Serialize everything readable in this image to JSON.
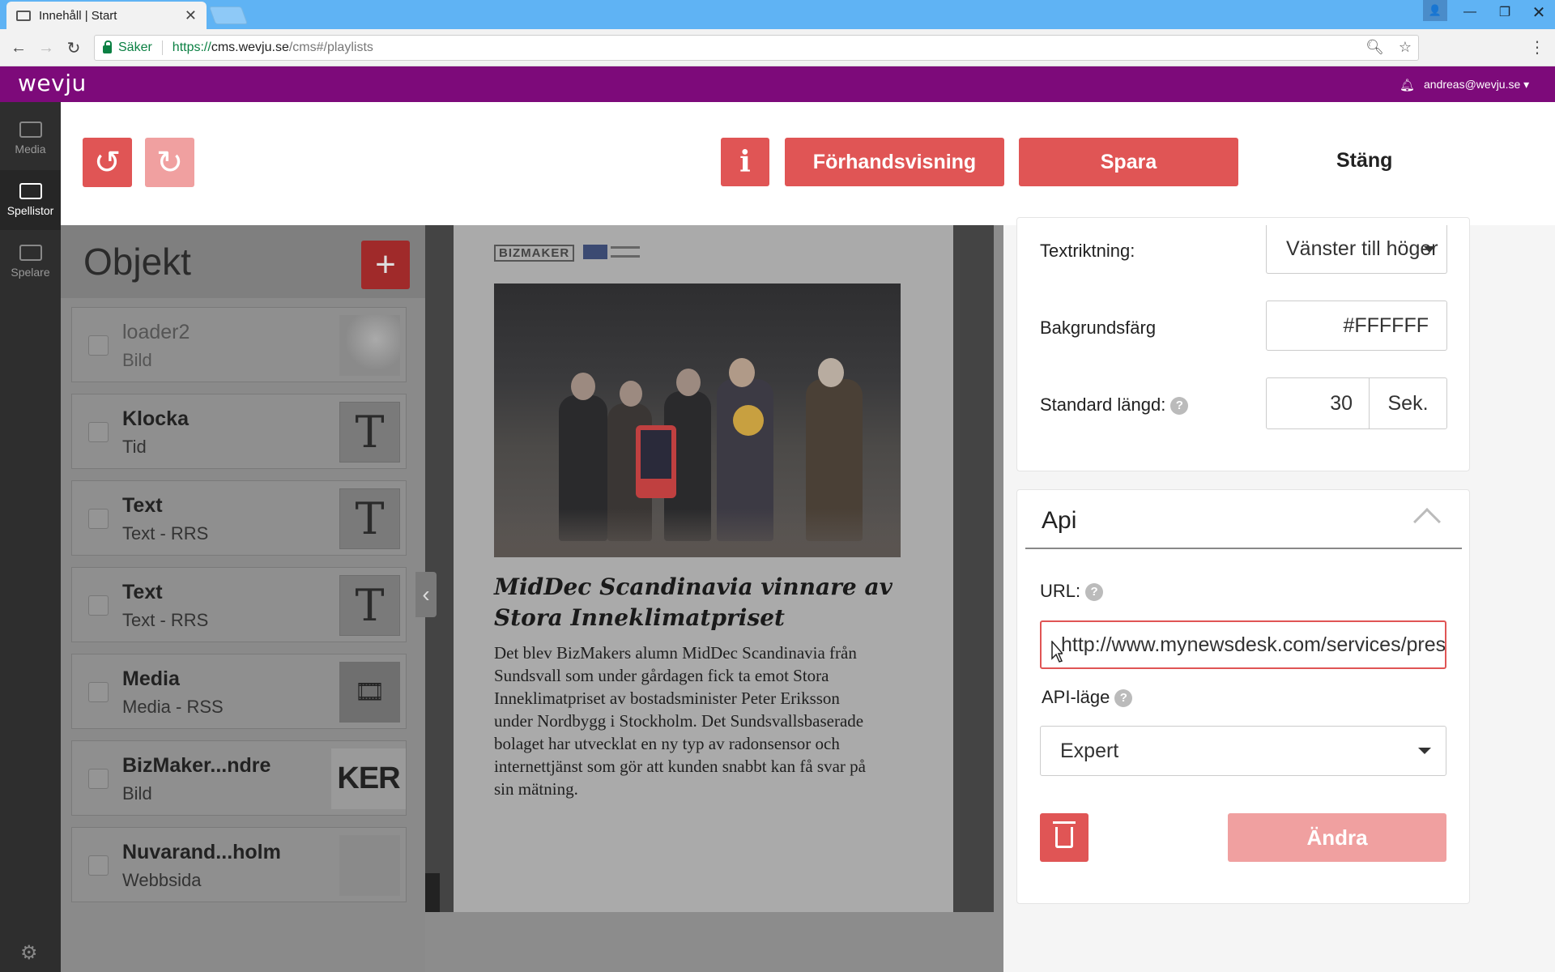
{
  "browser": {
    "tab_title": "Innehåll | Start",
    "secure_label": "Säker",
    "url_proto": "https://",
    "url_host": "cms.wevju.se",
    "url_path": "/cms#/playlists"
  },
  "app": {
    "logo": "wevju",
    "user_email": "andreas@wevju.se ▾"
  },
  "leftnav": {
    "items": [
      {
        "label": "Media",
        "icon": "media-icon"
      },
      {
        "label": "Spellistor",
        "icon": "playlist-icon"
      },
      {
        "label": "Spelare",
        "icon": "monitor-icon"
      }
    ]
  },
  "toolbar": {
    "preview_label": "Förhandsvisning",
    "save_label": "Spara",
    "close_label": "Stäng",
    "info_label": "i"
  },
  "objekt": {
    "title": "Objekt",
    "add_label": "+",
    "items": [
      {
        "name": "loader2",
        "type": "Bild",
        "thumb": "image"
      },
      {
        "name": "Klocka",
        "type": "Tid",
        "thumb": "T"
      },
      {
        "name": "Text",
        "type": "Text - RRS",
        "thumb": "T"
      },
      {
        "name": "Text",
        "type": "Text - RRS",
        "thumb": "T"
      },
      {
        "name": "Media",
        "type": "Media - RSS",
        "thumb": "film-reel"
      },
      {
        "name": "BizMaker...ndre",
        "type": "Bild",
        "thumb": "KER"
      },
      {
        "name": "Nuvarand...holm",
        "type": "Webbsida",
        "thumb": "blank"
      }
    ]
  },
  "preview": {
    "logo_text": "BIZMAKER",
    "headline": "MidDec Scandinavia vinnare av Stora Inneklimatpriset",
    "body": "Det blev BizMakers alumn MidDec Scandinavia från Sundsvall som under gårdagen fick ta emot Stora Inneklimatpriset av bostadsminister Peter Eriksson under Nordbygg i Stockholm. Det Sundsvallsbaserade bolaget har utvecklat en ny typ av radonsensor och internettjänst som gör att kunden snabbt kan få svar på sin mätning."
  },
  "settings": {
    "text_direction_label": "Textriktning:",
    "text_direction_value": "Vänster till höger",
    "bg_color_label": "Bakgrundsfärg",
    "bg_color_value": "#FFFFFF",
    "default_length_label": "Standard längd:",
    "default_length_value": "30",
    "default_length_unit": "Sek."
  },
  "api": {
    "title": "Api",
    "url_label": "URL:",
    "url_value": "http://www.mynewsdesk.com/services/pressroom/list",
    "mode_label": "API-läge",
    "mode_value": "Expert",
    "change_label": "Ändra"
  },
  "colors": {
    "brand_purple": "#7d0a7a",
    "accent_red": "#e05555",
    "accent_red_light": "#f0a0a0"
  }
}
